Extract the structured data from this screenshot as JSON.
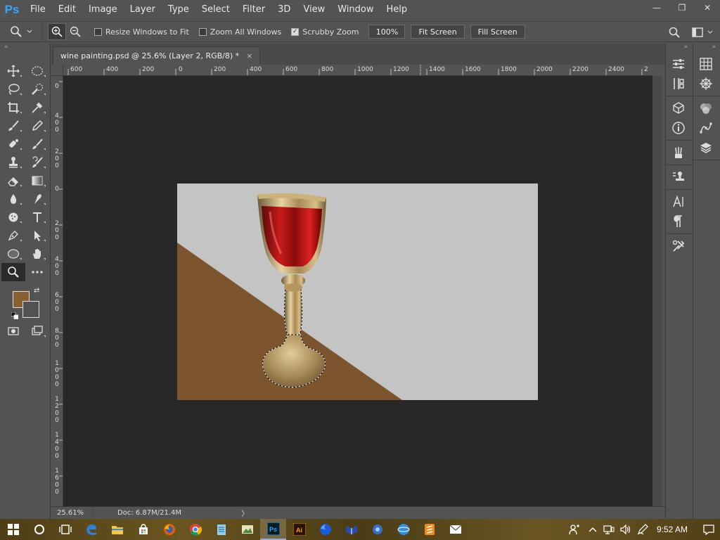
{
  "app": {
    "logo": "Ps",
    "accent": "#31a8ff"
  },
  "menu": [
    "File",
    "Edit",
    "Image",
    "Layer",
    "Type",
    "Select",
    "Filter",
    "3D",
    "View",
    "Window",
    "Help"
  ],
  "window_controls": {
    "minimize": "—",
    "restore": "❐",
    "close": "✕"
  },
  "options": {
    "resize_windows": {
      "label": "Resize Windows to Fit",
      "checked": false
    },
    "zoom_all": {
      "label": "Zoom All Windows",
      "checked": false
    },
    "scrubby": {
      "label": "Scrubby Zoom",
      "checked": true
    },
    "zoom_value": "100%",
    "fit_screen": "Fit Screen",
    "fill_screen": "Fill Screen"
  },
  "document": {
    "tab_title": "wine painting.psd @ 25.6% (Layer 2, RGB/8) *",
    "close": "×"
  },
  "ruler": {
    "top": [
      "600",
      "400",
      "200",
      "0",
      "200",
      "400",
      "600",
      "800",
      "1000",
      "1200",
      "1400",
      "1600",
      "1800",
      "2000",
      "2200",
      "2400",
      "2"
    ],
    "left": [
      "0",
      "400",
      "200",
      "0",
      "200",
      "400",
      "600",
      "800",
      "1000",
      "1200",
      "1400",
      "1600"
    ]
  },
  "colors": {
    "foreground": "#8a6031",
    "background": "#535353",
    "floor": "#7c552e",
    "wall": "#c4c4c4"
  },
  "status": {
    "zoom": "25.61%",
    "doc": "Doc: 6.87M/21.4M",
    "arrow": "〉"
  },
  "clock": "9:52 AM"
}
